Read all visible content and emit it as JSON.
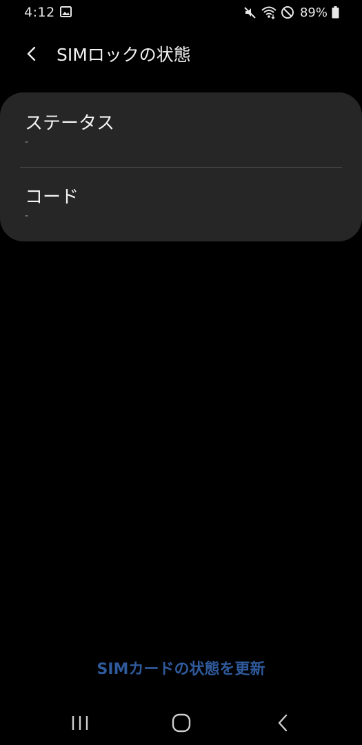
{
  "status_bar": {
    "time": "4:12",
    "battery_percent": "89%",
    "icons": [
      "gallery-icon",
      "mute-icon",
      "wifi-icon",
      "do-not-disturb-icon",
      "battery-icon"
    ]
  },
  "header": {
    "back_icon": "back-arrow-icon",
    "title": "SIMロックの状態"
  },
  "card": {
    "items": [
      {
        "title": "ステータス",
        "value": "-"
      },
      {
        "title": "コード",
        "value": "-"
      }
    ]
  },
  "refresh_button": {
    "label": "SIMカードの状態を更新",
    "color": "#2f5a9c"
  },
  "nav_bar": {
    "buttons": [
      "recents-icon",
      "home-icon",
      "back-icon"
    ]
  },
  "colors": {
    "background": "#000000",
    "card": "#262626",
    "divider": "#4a4a4a",
    "accent": "#2f5a9c"
  }
}
